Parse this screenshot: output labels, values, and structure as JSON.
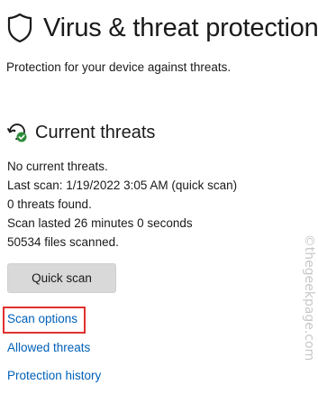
{
  "header": {
    "title": "Virus & threat protection",
    "subtitle": "Protection for your device against threats.",
    "icon": "shield-icon"
  },
  "current_threats": {
    "title": "Current threats",
    "icon": "threat-scan-check-icon",
    "status_lines": [
      "No current threats.",
      "Last scan: 1/19/2022 3:05 AM (quick scan)",
      "0 threats found.",
      "Scan lasted 26 minutes 0 seconds",
      "50534 files scanned."
    ],
    "quick_scan_label": "Quick scan"
  },
  "links": {
    "scan_options": "Scan options",
    "allowed_threats": "Allowed threats",
    "protection_history": "Protection history"
  },
  "watermark": "©thegeekpage.com",
  "colors": {
    "link": "#0060b8",
    "highlight": "#e0312f",
    "button_bg": "#d9d9d9",
    "check_green": "#2e8b3a"
  }
}
